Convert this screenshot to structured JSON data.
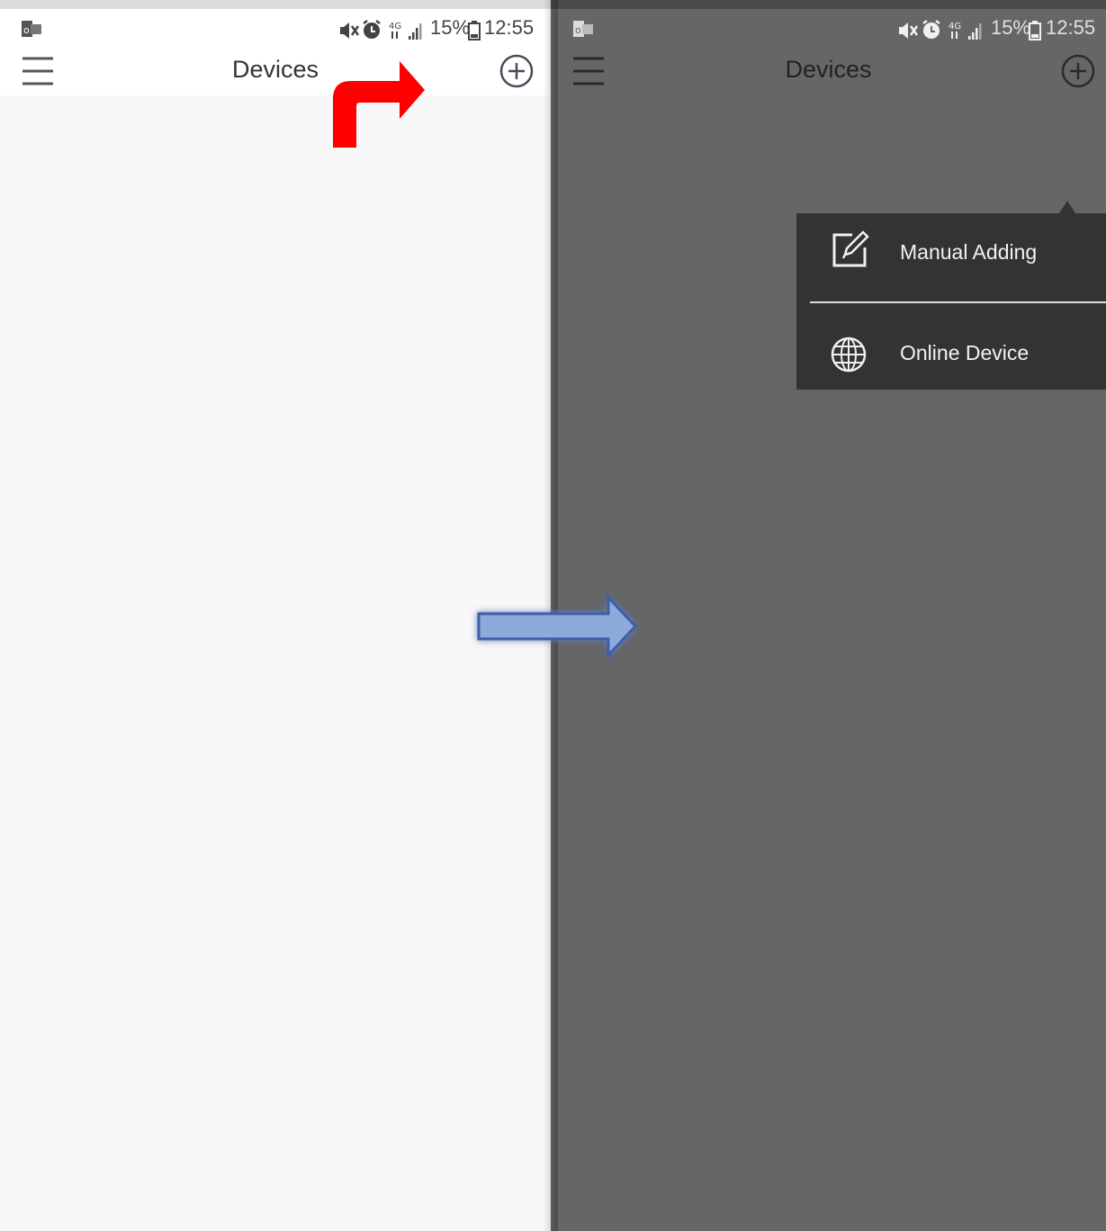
{
  "left_screen": {
    "status": {
      "battery": "15%",
      "time": "12:55"
    },
    "header": {
      "title": "Devices"
    }
  },
  "right_screen": {
    "status": {
      "battery": "15%",
      "time": "12:55"
    },
    "header": {
      "title": "Devices"
    },
    "add_menu": {
      "items": [
        {
          "label": "Manual Adding",
          "icon": "edit-icon"
        },
        {
          "label": "Online Device",
          "icon": "globe-icon"
        }
      ]
    }
  },
  "annotations": {
    "red_arrow_color": "#ff0000",
    "blue_arrow_color": "#8eaadb"
  }
}
